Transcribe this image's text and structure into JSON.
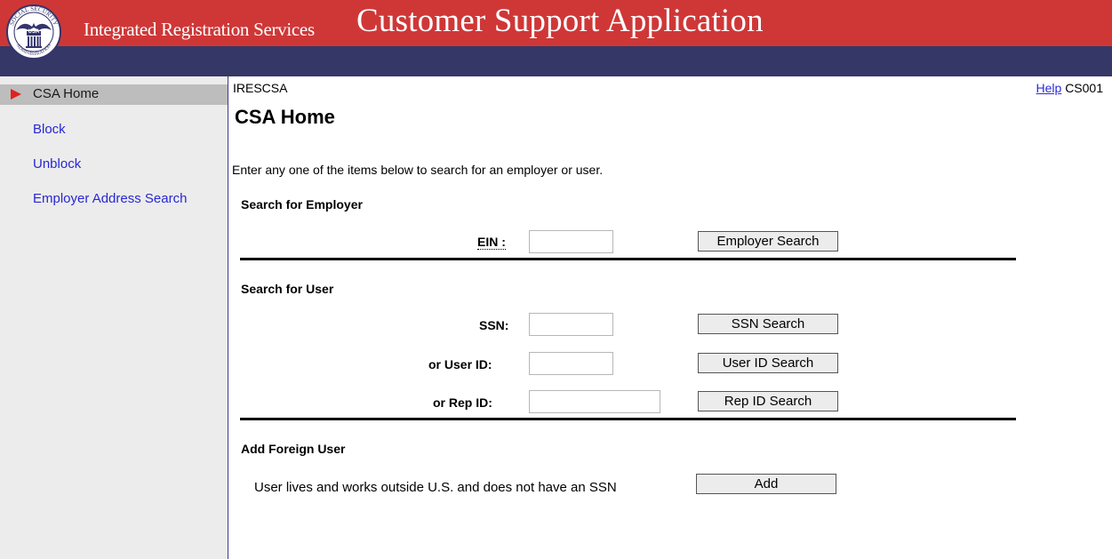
{
  "header": {
    "app_name": "Integrated Registration Services",
    "app_title": "Customer Support Application",
    "seal_text": "SOCIAL SECURITY ADMINISTRATION USA"
  },
  "sidebar": {
    "items": [
      {
        "label": "CSA Home",
        "active": true
      },
      {
        "label": "Block"
      },
      {
        "label": "Unblock"
      },
      {
        "label": "Employer Address Search"
      }
    ]
  },
  "main": {
    "screen_code": "IRESCSA",
    "help_link": "Help",
    "screen_id": "CS001",
    "page_title": "CSA Home",
    "intro": "Enter any one of the items below to search for an employer or user.",
    "employer_section": {
      "title": "Search for Employer",
      "ein_label": "EIN :",
      "ein_value": "",
      "search_button": "Employer Search"
    },
    "user_section": {
      "title": "Search for User",
      "ssn_label": "SSN:",
      "ssn_value": "",
      "ssn_button": "SSN Search",
      "userid_label": "or User ID:",
      "userid_value": "",
      "userid_button": "User ID Search",
      "repid_label": "or Rep ID:",
      "repid_value": "",
      "repid_button": "Rep ID Search"
    },
    "foreign_section": {
      "title": "Add Foreign User",
      "note": "User lives and works outside U.S. and does not have an SSN",
      "add_button": "Add"
    }
  },
  "colors": {
    "banner": "#cf3737",
    "nav_strip": "#353766",
    "sidebar_bg": "#ececec",
    "link": "#2727d6",
    "active_arrow": "#e02020"
  }
}
